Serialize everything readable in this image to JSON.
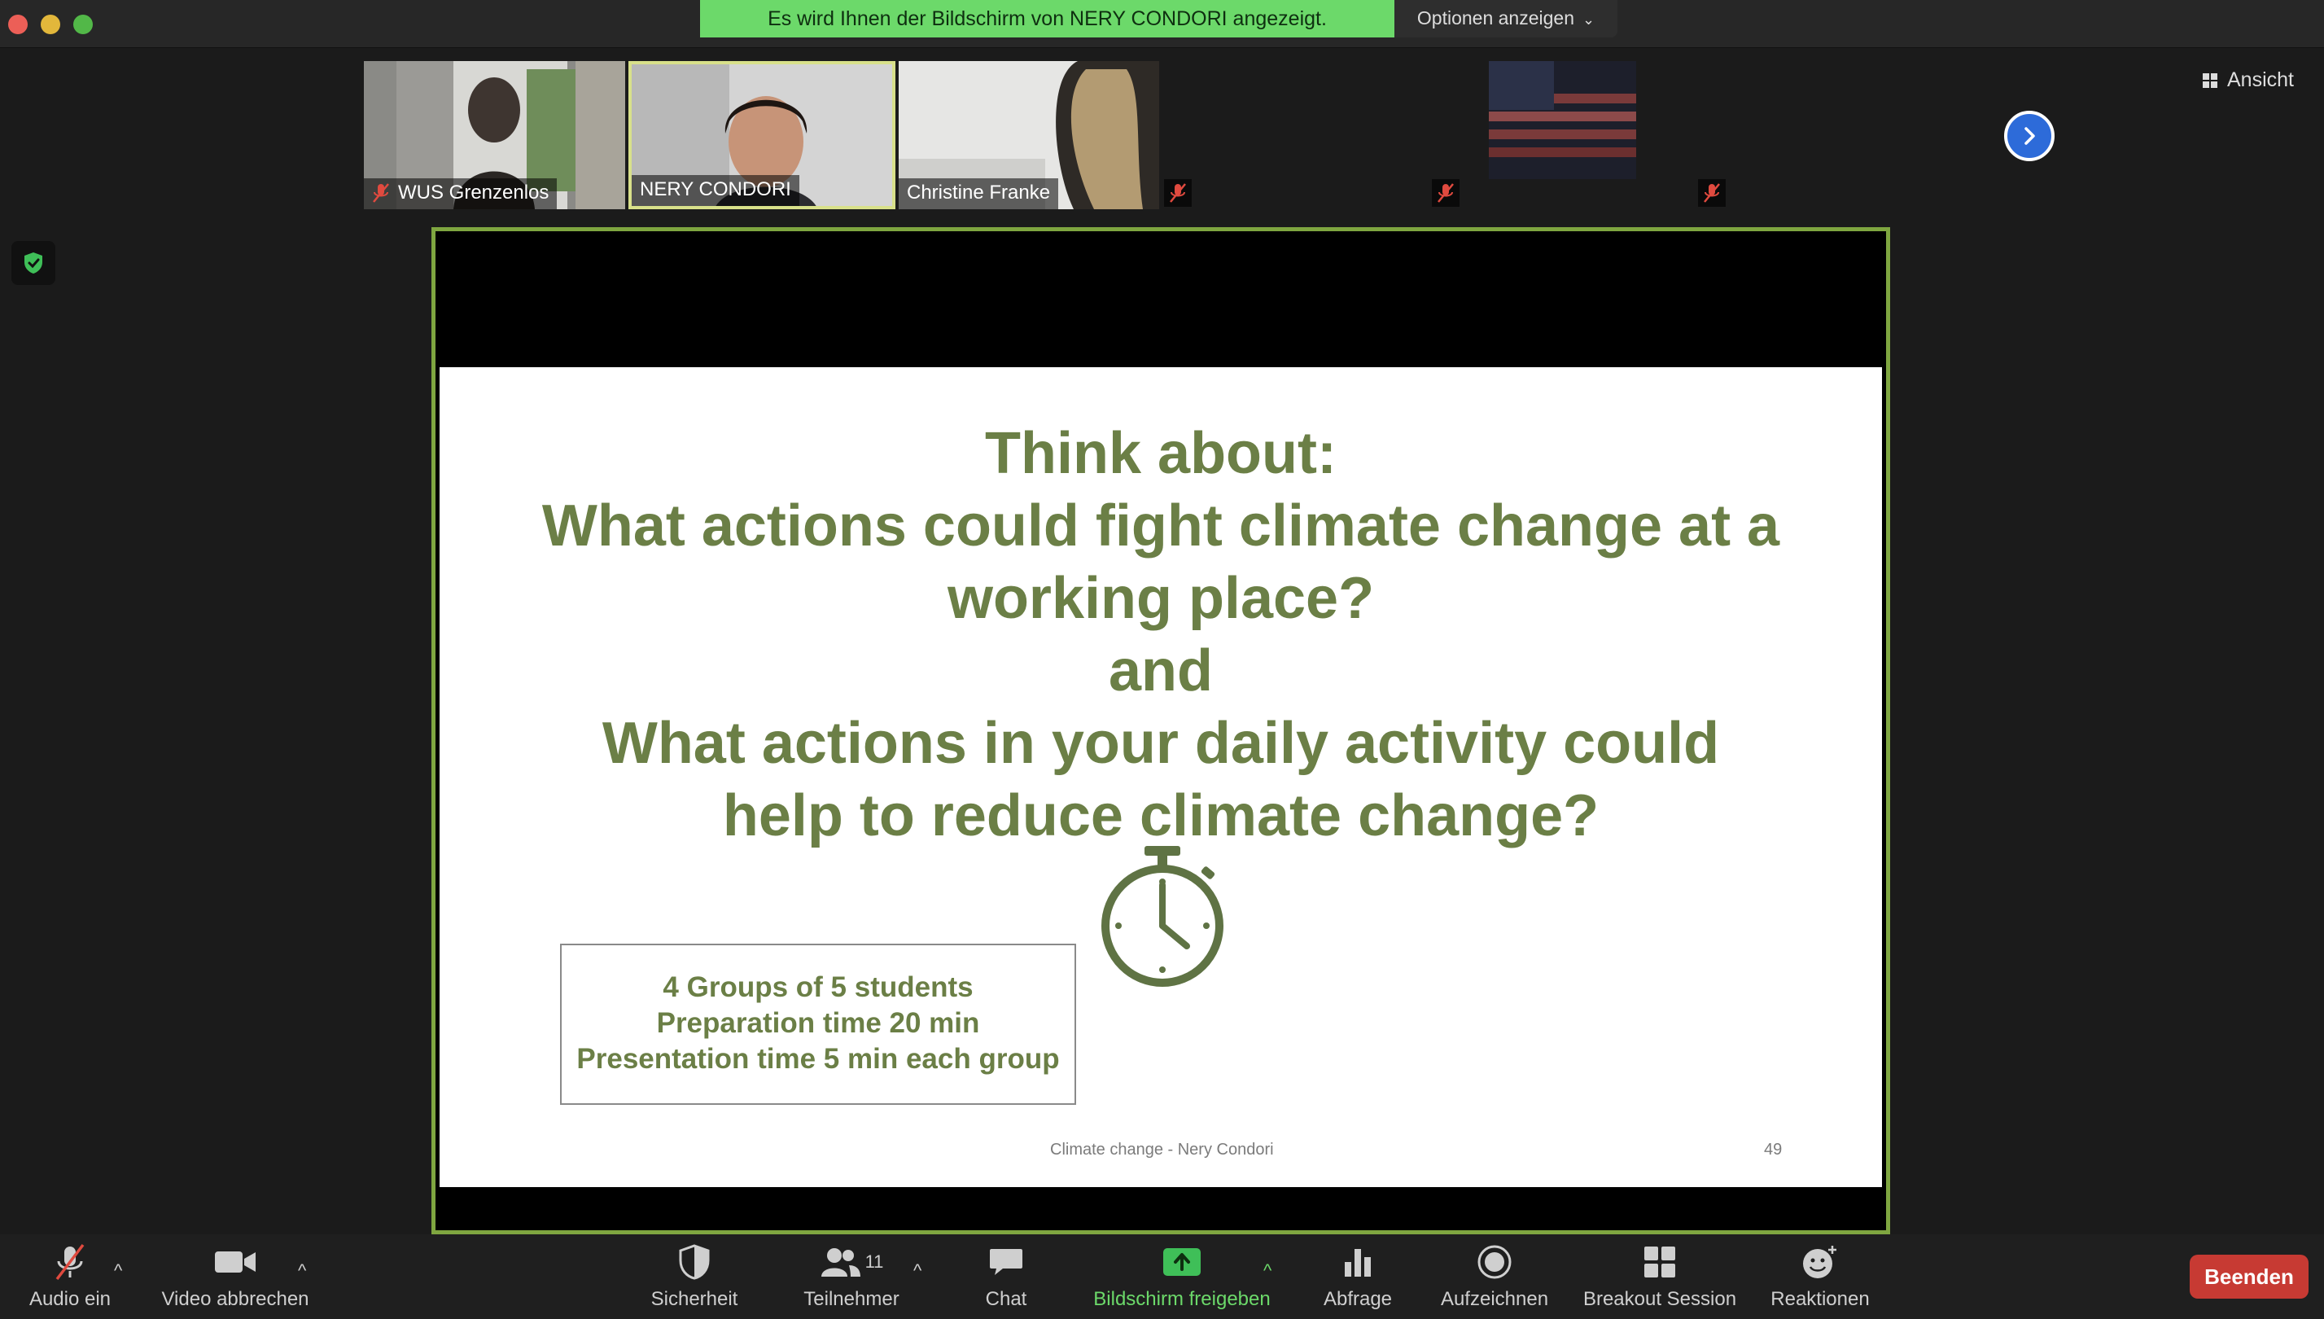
{
  "window": {
    "traffic_lights": [
      "close",
      "minimize",
      "zoom"
    ]
  },
  "share_banner": {
    "text": "Es wird Ihnen der Bildschirm von NERY CONDORI angezeigt.",
    "options_label": "Optionen anzeigen"
  },
  "view_button": {
    "label": "Ansicht"
  },
  "participants": [
    {
      "name": "WUS Grenzenlos",
      "muted": true
    },
    {
      "name": "NERY CONDORI",
      "muted": false,
      "active": true
    },
    {
      "name": "Christine Franke",
      "muted": false
    },
    {
      "name": "",
      "muted": true
    },
    {
      "name": "",
      "muted": true
    },
    {
      "name": "",
      "muted": true
    }
  ],
  "slide": {
    "title_lines": [
      "Think about:",
      "What actions could fight climate change at a",
      "working place?",
      "and",
      "What actions in your daily activity could",
      "help to reduce climate change?"
    ],
    "info_lines": [
      "4 Groups of 5 students",
      "Preparation time 20 min",
      "Presentation time 5 min each group"
    ],
    "footer": "Climate change  - Nery Condori",
    "page_number": "49",
    "accent_color": "#6b7f46"
  },
  "toolbar": {
    "audio": "Audio ein",
    "video": "Video abbrechen",
    "security": "Sicherheit",
    "participants": "Teilnehmer",
    "participant_count": "11",
    "chat": "Chat",
    "share": "Bildschirm freigeben",
    "polls": "Abfrage",
    "record": "Aufzeichnen",
    "breakout": "Breakout Session",
    "reactions": "Reaktionen",
    "end": "Beenden"
  },
  "colors": {
    "share_banner": "#6cd96a",
    "end_button": "#c73a33",
    "next_button": "#2d6bd9",
    "presentation_border": "#7fa640"
  }
}
